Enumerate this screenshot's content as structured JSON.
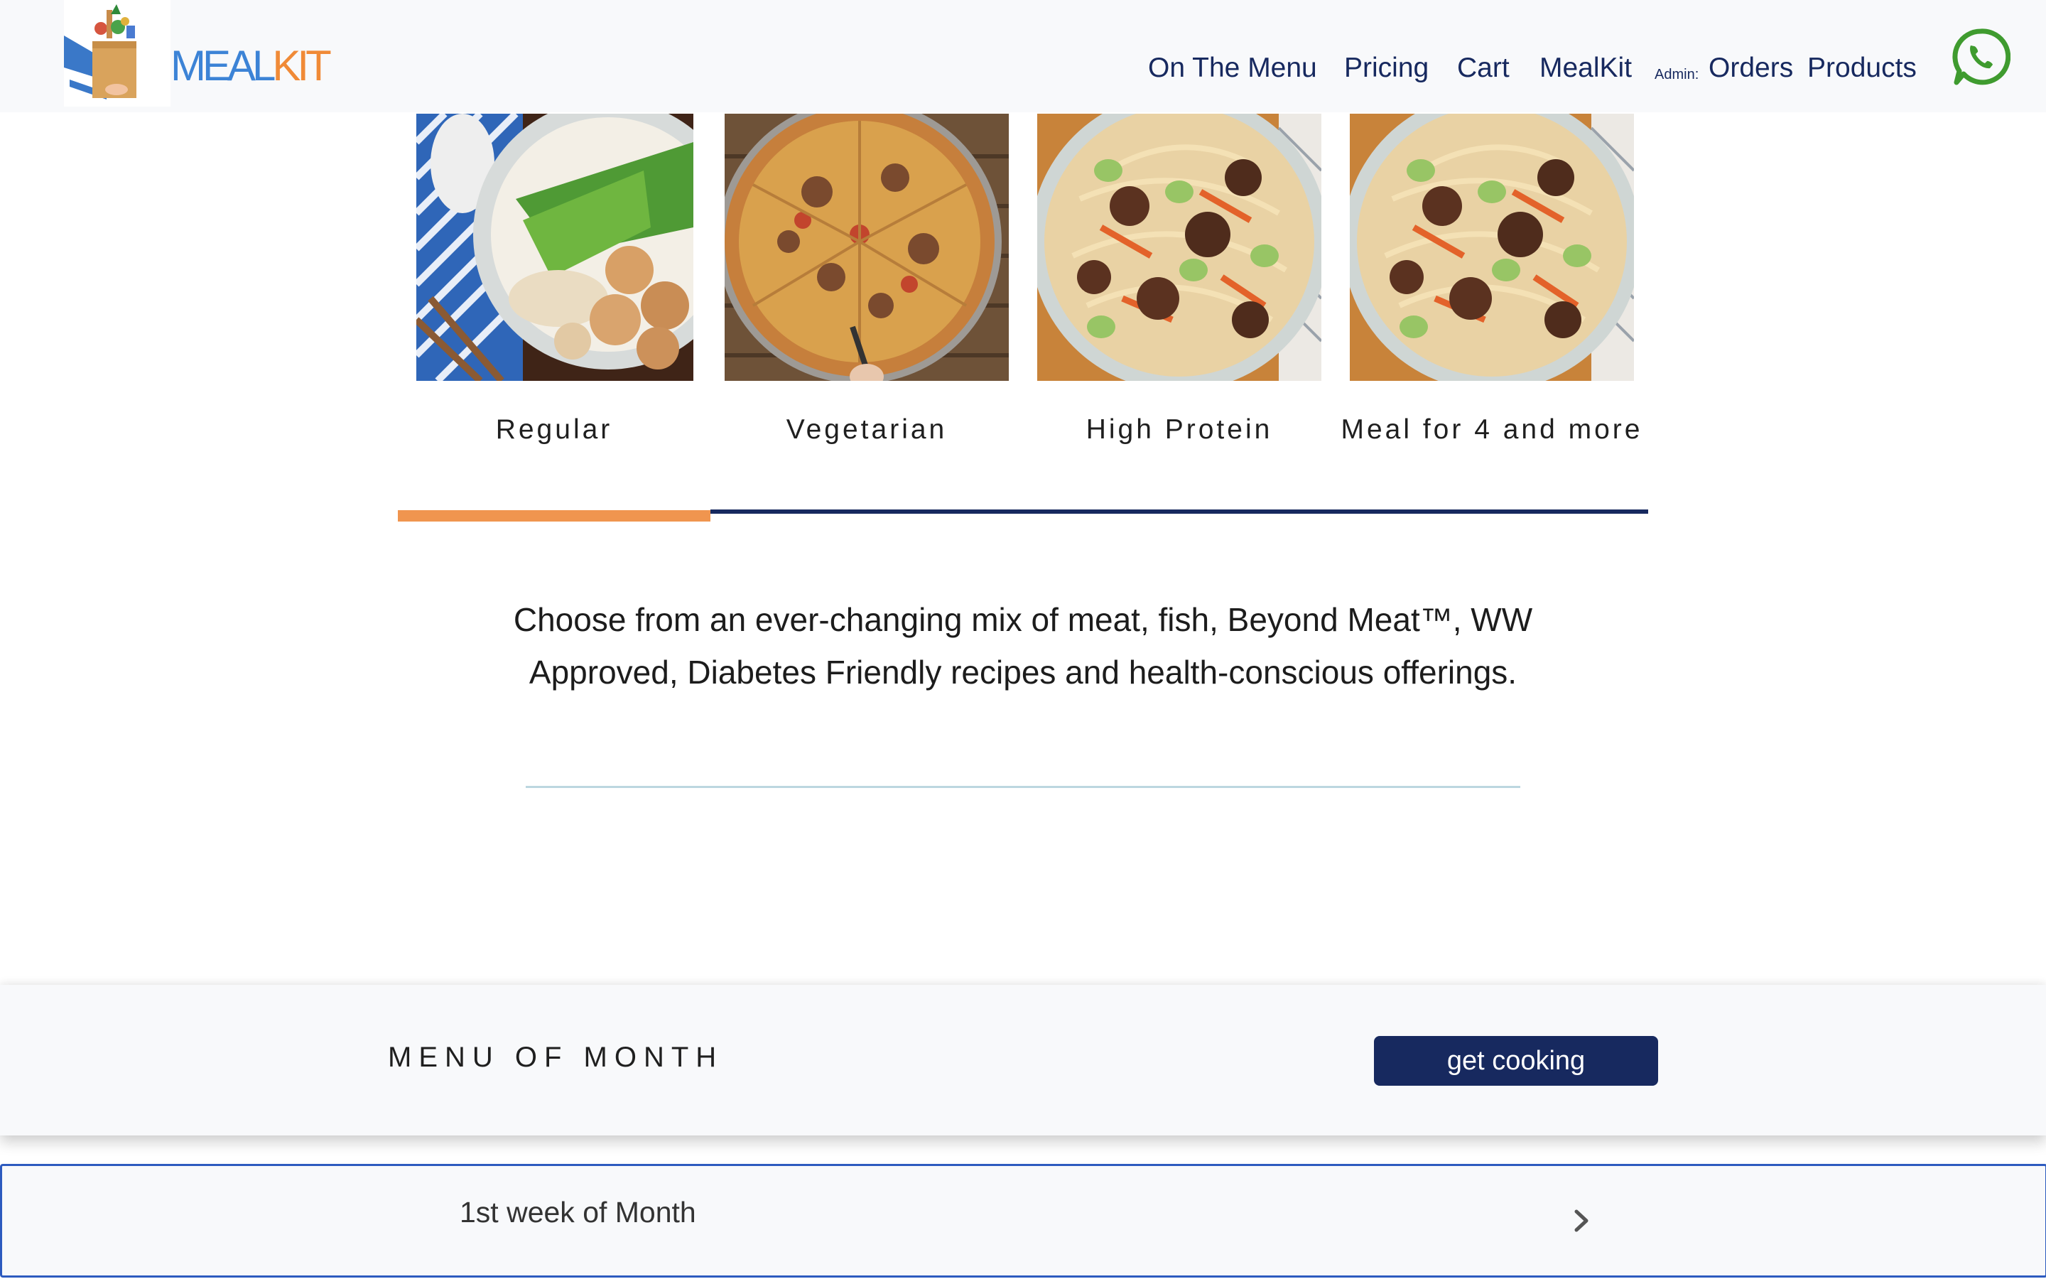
{
  "brand": {
    "name_part1": "MEAL",
    "name_part2": "KIT"
  },
  "nav": {
    "items": [
      "On The Menu",
      "Pricing",
      "Cart",
      "MealKit"
    ],
    "admin_label": "Admin:",
    "admin_items": [
      "Orders",
      "Products"
    ],
    "whatsapp_icon": "whatsapp-icon"
  },
  "categories": [
    {
      "label": "Regular",
      "image": "dumpling-noodle-bowl"
    },
    {
      "label": "Vegetarian",
      "image": "pizza"
    },
    {
      "label": "High Protein",
      "image": "beef-noodle-bowl"
    },
    {
      "label": "Meal for 4 and more",
      "image": "beef-noodle-bowl"
    }
  ],
  "active_category": "Regular",
  "description": "Choose from an ever-changing mix of meat, fish, Beyond Meat™, WW Approved, Diabetes Friendly recipes and health-conscious offerings.",
  "menu_of_month": {
    "title": "MENU OF MONTH",
    "button_label": "get cooking",
    "weeks": [
      {
        "label": "1st week of Month"
      }
    ]
  },
  "colors": {
    "navy": "#17295f",
    "orange": "#f0954f",
    "brand_blue": "#3c83d6",
    "brand_orange": "#f08a37",
    "whatsapp_green": "#3f9b2f"
  }
}
